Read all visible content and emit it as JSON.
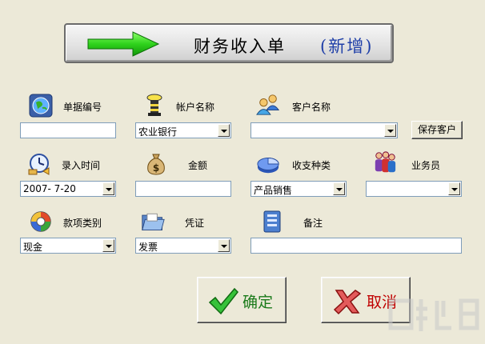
{
  "banner": {
    "title": "财务收入单",
    "mode": "(新增)"
  },
  "fields": {
    "doc_no": {
      "label": "单据编号",
      "value": ""
    },
    "account": {
      "label": "帐户名称",
      "value": "农业银行"
    },
    "customer": {
      "label": "客户名称",
      "value": ""
    },
    "entry_time": {
      "label": "录入时间",
      "value": "2007- 7-20"
    },
    "amount": {
      "label": "金额",
      "value": ""
    },
    "category": {
      "label": "收支种类",
      "value": "产品销售"
    },
    "salesperson": {
      "label": "业务员",
      "value": ""
    },
    "payment_type": {
      "label": "款项类别",
      "value": "现金"
    },
    "voucher": {
      "label": "凭证",
      "value": "发票"
    },
    "remark": {
      "label": "备注",
      "value": ""
    }
  },
  "buttons": {
    "save_customer": "保存客户",
    "ok": "确定",
    "cancel": "取消"
  },
  "colors": {
    "background": "#ECE9D8",
    "mode_text": "#1f3fa8",
    "ok_text": "#1a7a1a",
    "cancel_text": "#c00000"
  }
}
